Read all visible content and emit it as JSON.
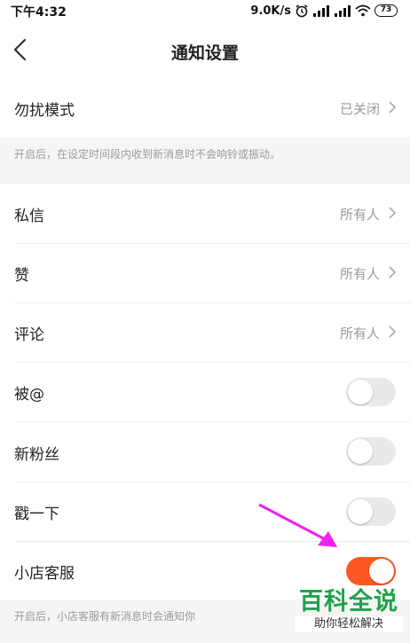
{
  "status_bar": {
    "time": "下午4:32",
    "speed": "9.0K/s",
    "battery": "73"
  },
  "nav": {
    "title": "通知设置"
  },
  "dnd": {
    "label": "勿扰模式",
    "value": "已关闭",
    "hint": "开启后，在设定时间段内收到新消息时不会响铃或振动。"
  },
  "items": [
    {
      "label": "私信",
      "value": "所有人"
    },
    {
      "label": "赞",
      "value": "所有人"
    },
    {
      "label": "评论",
      "value": "所有人"
    },
    {
      "label": "被@",
      "enabled": false
    },
    {
      "label": "新粉丝",
      "enabled": false
    },
    {
      "label": "戳一下",
      "enabled": false
    },
    {
      "label": "小店客服",
      "enabled": true
    }
  ],
  "footer_hint": "开启后，小店客服有新消息时会通知你",
  "watermark": {
    "title": "百科全说",
    "subtitle": "助你轻松解决"
  },
  "colors": {
    "toggle_on": "#ff5722",
    "toggle_off": "#e9e9e9",
    "arrow": "#ee22ee",
    "watermark": "#20a14b"
  },
  "icons": [
    "back-icon",
    "chevron-right-icon",
    "alarm-icon",
    "signal-icon",
    "wifi-icon",
    "battery-icon"
  ]
}
